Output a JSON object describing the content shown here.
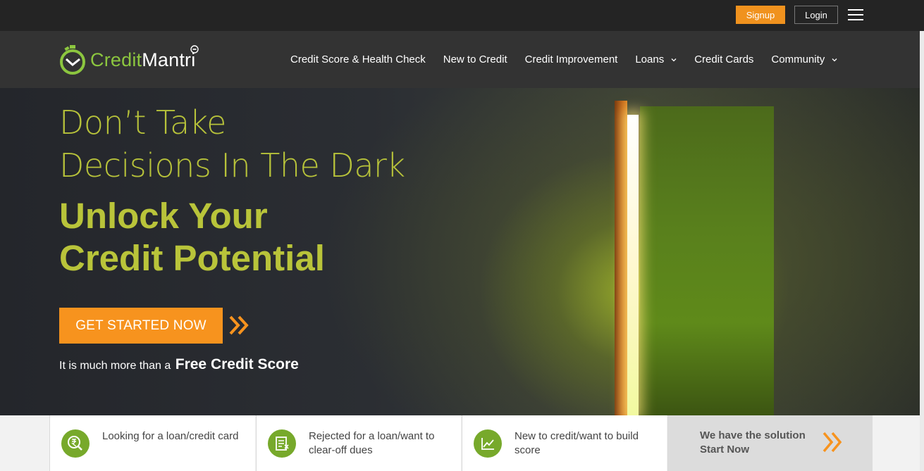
{
  "topbar": {
    "signup_label": "Signup",
    "login_label": "Login"
  },
  "brand": {
    "name_part1": "Credit",
    "name_part2": "Mantri",
    "accent_color": "#8cc63f"
  },
  "nav": {
    "items": [
      {
        "label": "Credit Score & Health Check",
        "dropdown": false
      },
      {
        "label": "New to Credit",
        "dropdown": false
      },
      {
        "label": "Credit Improvement",
        "dropdown": false
      },
      {
        "label": "Loans",
        "dropdown": true
      },
      {
        "label": "Credit Cards",
        "dropdown": false
      },
      {
        "label": "Community",
        "dropdown": true
      }
    ]
  },
  "hero": {
    "line1": "Don’t Take",
    "line2": "Decisions In The Dark",
    "bold1": "Unlock Your",
    "bold2": "Credit Potential",
    "cta_label": "GET STARTED NOW",
    "sub_prefix": "It is much more than a",
    "sub_bold": "Free Credit Score",
    "headline_color": "#b9c43a",
    "cta_color": "#f7931e"
  },
  "strip": {
    "cards": [
      {
        "label": "Looking for a loan/credit card",
        "icon": "rupee-search-icon"
      },
      {
        "label": "Rejected for a loan/want to clear-off dues",
        "icon": "document-icon"
      },
      {
        "label": "New to credit/want to build score",
        "icon": "chart-icon"
      }
    ],
    "solution_line1": "We have the solution",
    "solution_line2": "Start Now"
  }
}
